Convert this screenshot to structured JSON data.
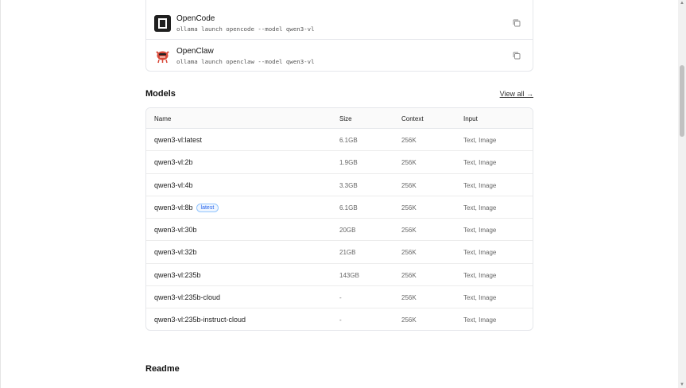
{
  "integrations": [
    {
      "name": "OpenCode",
      "command": "ollama launch opencode --model qwen3-vl",
      "logo": "opencode-logo"
    },
    {
      "name": "OpenClaw",
      "command": "ollama launch openclaw --model qwen3-vl",
      "logo": "openclaw-logo"
    }
  ],
  "models": {
    "title": "Models",
    "view_all": "View all →",
    "headers": {
      "name": "Name",
      "size": "Size",
      "context": "Context",
      "input": "Input"
    },
    "rows": [
      {
        "name": "qwen3-vl:latest",
        "size": "6.1GB",
        "context": "256K",
        "input": "Text, Image"
      },
      {
        "name": "qwen3-vl:2b",
        "size": "1.9GB",
        "context": "256K",
        "input": "Text, Image"
      },
      {
        "name": "qwen3-vl:4b",
        "size": "3.3GB",
        "context": "256K",
        "input": "Text, Image"
      },
      {
        "name": "qwen3-vl:8b",
        "badge": "latest",
        "size": "6.1GB",
        "context": "256K",
        "input": "Text, Image"
      },
      {
        "name": "qwen3-vl:30b",
        "size": "20GB",
        "context": "256K",
        "input": "Text, Image"
      },
      {
        "name": "qwen3-vl:32b",
        "size": "21GB",
        "context": "256K",
        "input": "Text, Image"
      },
      {
        "name": "qwen3-vl:235b",
        "size": "143GB",
        "context": "256K",
        "input": "Text, Image"
      },
      {
        "name": "qwen3-vl:235b-cloud",
        "size": "-",
        "context": "256K",
        "input": "Text, Image"
      },
      {
        "name": "qwen3-vl:235b-instruct-cloud",
        "size": "-",
        "context": "256K",
        "input": "Text, Image"
      }
    ]
  },
  "readme": {
    "title": "Readme"
  },
  "icons": {
    "copy": "copy-icon"
  }
}
